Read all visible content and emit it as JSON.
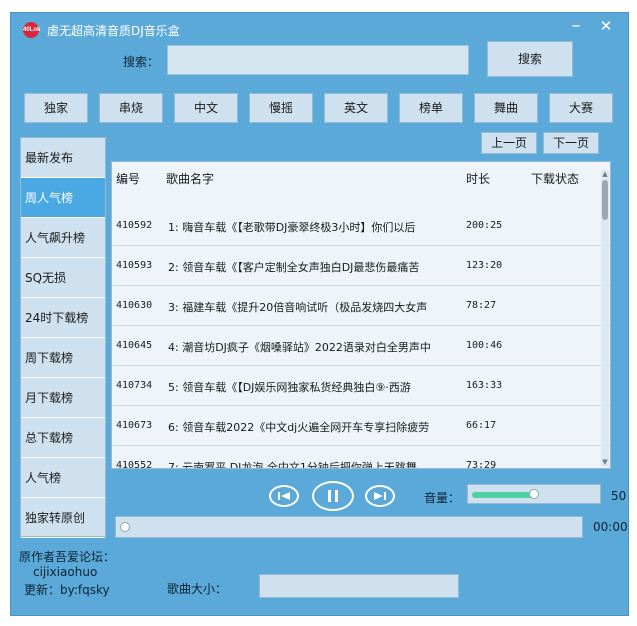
{
  "app": {
    "title": "虐无超高清音质DJ音乐盒",
    "logo_text": "40Lok",
    "minimize_symbol": "–",
    "close_symbol": "✕"
  },
  "search": {
    "label": "搜索：",
    "value": "",
    "placeholder": "",
    "button_label": "搜索"
  },
  "categories": [
    "独家",
    "串烧",
    "中文",
    "慢摇",
    "英文",
    "榜单",
    "舞曲",
    "大赛"
  ],
  "pager": {
    "prev_label": "上一页",
    "next_label": "下一页"
  },
  "sidebar": {
    "active_index": 1,
    "items": [
      {
        "label": "最新发布"
      },
      {
        "label": "周人气榜"
      },
      {
        "label": "人气飙升榜"
      },
      {
        "label": "SQ无损"
      },
      {
        "label": "24时下载榜"
      },
      {
        "label": "周下载榜"
      },
      {
        "label": "月下载榜"
      },
      {
        "label": "总下载榜"
      },
      {
        "label": "人气榜"
      },
      {
        "label": "独家转原创"
      }
    ]
  },
  "table": {
    "headers": {
      "id": "编号",
      "name": "歌曲名字",
      "duration": "时长",
      "status": "下载状态"
    },
    "rows": [
      {
        "id": "410592",
        "name": "1: 嗨音车载《【老歌带DJ豪翠终极3小时】你们以后",
        "duration": "200:25",
        "status": ""
      },
      {
        "id": "410593",
        "name": "2: 领音车载《【客户定制全女声独白DJ最悲伤最痛苦",
        "duration": "123:20",
        "status": ""
      },
      {
        "id": "410630",
        "name": "3: 福建车载《提升20倍音响试听（极品发烧四大女声",
        "duration": "78:27",
        "status": ""
      },
      {
        "id": "410645",
        "name": "4: 潮音坊DJ疯子《烟嗓驿站》2022语录对白全男声中",
        "duration": "100:46",
        "status": ""
      },
      {
        "id": "410734",
        "name": "5: 领音车载《【DJ娱乐网独家私货经典独白⑨·西游",
        "duration": "163:33",
        "status": ""
      },
      {
        "id": "410673",
        "name": "6: 领音车载2022《中文dj火遍全网开车专享扫除疲劳",
        "duration": "66:17",
        "status": ""
      },
      {
        "id": "410552",
        "name": "7: 云南罗平  DJ龙泡 全中文1分钟后把你弹上天跳舞",
        "duration": "73:29",
        "status": ""
      }
    ]
  },
  "player": {
    "prev_icon": "previous-track-icon",
    "pause_icon": "pause-icon",
    "next_icon": "next-track-icon",
    "volume_label": "音量：",
    "volume_value": "50",
    "volume_level_percent": 50,
    "progress_fraction": 0,
    "time": "00:00",
    "accent_color": "#4fd1a5"
  },
  "footer": {
    "author_label": "原作者吾爱论坛：",
    "author_name": "cijixiaohuo",
    "update_text": "更新：by:fqsky",
    "size_label": "歌曲大小：",
    "size_value": ""
  }
}
